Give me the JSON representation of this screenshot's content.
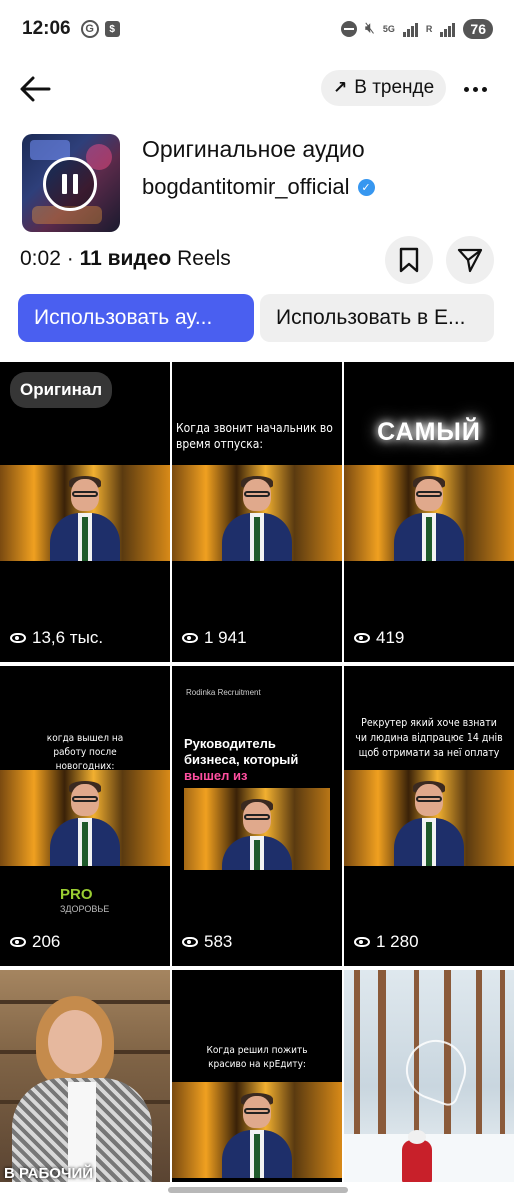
{
  "status_bar": {
    "time": "12:06",
    "net_5g": "5G",
    "net_r": "R",
    "battery": "76"
  },
  "header": {
    "trend_label": "В тренде"
  },
  "audio": {
    "title": "Оригинальное аудио",
    "author": "bogdantitomir_official",
    "duration": "0:02",
    "separator": "·",
    "video_count": "11 видео",
    "reels_label": "Reels",
    "use_audio_button": "Использовать ау...",
    "use_in_edits_button": "Использовать в E..."
  },
  "grid": {
    "tiles": [
      {
        "badge": "Оригинал",
        "views": "13,6 тыс."
      },
      {
        "caption": "Когда звонит начальник во время отпуска:",
        "views": "1 941"
      },
      {
        "caption": "САМЫЙ",
        "views": "419"
      },
      {
        "caption": "когда вышел на работу после новогодних:",
        "logo_main": "PRO",
        "logo_sub": "ЗДОРОВЬЕ",
        "views": "206"
      },
      {
        "brand": "Rodinka Recruitment",
        "caption_line1": "Руководитель",
        "caption_line2": "бизнеса, который",
        "caption_pink": "вышел из операционки",
        "views": "583"
      },
      {
        "caption": "Рекрутер який хоче взнати чи людина відпрацює 14 днів щоб отримати за неї оплату",
        "views": "1 280"
      },
      {
        "caption": "В РАБОЧИЙ"
      },
      {
        "caption": "Когда решил пожить красиво на крЕдиту:"
      },
      {}
    ]
  },
  "colors": {
    "accent": "#4a5ff0",
    "verified": "#3797f0",
    "pill_bg": "#efefef",
    "pink_text": "#ff4fa0"
  },
  "icons": {
    "back": "arrow-left-icon",
    "trend": "arrow-up-right-icon",
    "more": "more-horizontal-icon",
    "pause": "pause-icon",
    "verified": "verified-badge-icon",
    "save": "bookmark-icon",
    "share": "send-icon",
    "views": "eye-icon"
  }
}
